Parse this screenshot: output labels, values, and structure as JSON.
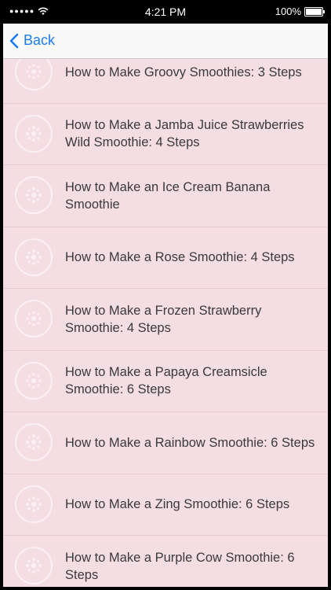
{
  "status_bar": {
    "signal": "●●●●●",
    "time": "4:21 PM",
    "battery": "100%"
  },
  "nav": {
    "back_label": "Back"
  },
  "items": [
    {
      "title": "How to Make Groovy Smoothies: 3 Steps"
    },
    {
      "title": "How to Make a Jamba Juice Strawberries Wild Smoothie: 4 Steps"
    },
    {
      "title": "How to Make an Ice Cream Banana Smoothie"
    },
    {
      "title": "How to Make a Rose Smoothie: 4 Steps"
    },
    {
      "title": "How to Make a Frozen Strawberry Smoothie: 4 Steps"
    },
    {
      "title": "How to Make a Papaya Creamsicle Smoothie: 6 Steps"
    },
    {
      "title": "How to Make a Rainbow Smoothie: 6 Steps"
    },
    {
      "title": "How to Make a Zing Smoothie: 6 Steps"
    },
    {
      "title": "How to Make a Purple Cow Smoothie: 6 Steps"
    }
  ],
  "colors": {
    "background": "#f4dde3",
    "accent": "#1a7cf5",
    "text": "#3a3a3a"
  }
}
